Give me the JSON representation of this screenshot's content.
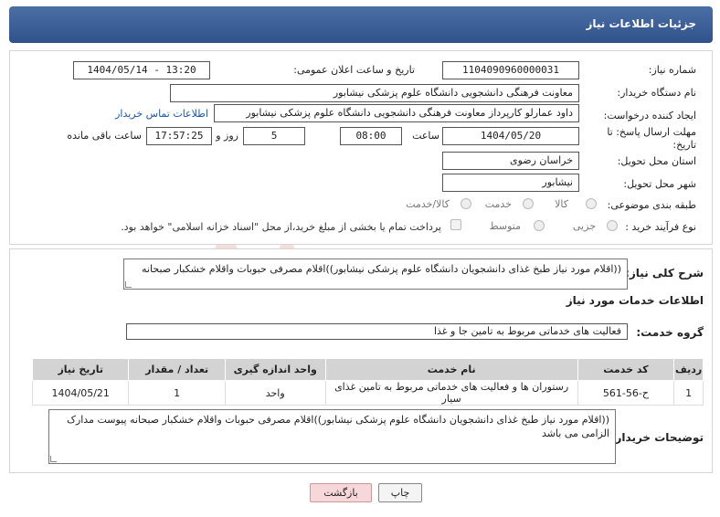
{
  "header": {
    "title": "جزئیات اطلاعات نیاز"
  },
  "need_number": {
    "label": "شماره نیاز:",
    "value": "1104090960000031"
  },
  "announce_datetime": {
    "label": "تاریخ و ساعت اعلان عمومی:",
    "value": "1404/05/14 - 13:20"
  },
  "buyer_org": {
    "label": "نام دستگاه خریدار:",
    "value": "معاونت فرهنگی دانشجویی دانشگاه علوم پزشکی نیشابور"
  },
  "requester": {
    "label": "ایجاد کننده درخواست:",
    "value": "داود عمارلو کارپرداز معاونت فرهنگی دانشجویی دانشگاه علوم پزشکی نیشابور",
    "contact_link": "اطلاعات تماس خریدار"
  },
  "deadline": {
    "label_line1": "مهلت ارسال پاسخ: تا",
    "label_line2": "تاریخ:",
    "date": "1404/05/20",
    "time_label": "ساعت",
    "time": "08:00",
    "days": "5",
    "days_label": "روز و",
    "remaining": "17:57:25",
    "remaining_label": "ساعت باقی مانده"
  },
  "province": {
    "label": "استان محل تحویل:",
    "value": "خراسان رضوی"
  },
  "city": {
    "label": "شهر محل تحویل:",
    "value": "نیشابور"
  },
  "category": {
    "label": "طبقه بندی موضوعی:",
    "options": [
      "کالا",
      "خدمت",
      "کالا/خدمت"
    ],
    "selected": "خدمت"
  },
  "purchase_type": {
    "label": "نوع فرآیند خرید :",
    "options": [
      "جزیی",
      "متوسط"
    ],
    "note": "پرداخت تمام یا بخشی از مبلغ خرید،از محل \"اسناد خزانه اسلامی\" خواهد بود."
  },
  "summary": {
    "label": "شرح کلی نیاز:",
    "value": "((اقلام مورد نیاز طبخ غذای دانشجویان دانشگاه علوم پزشکی نیشابور))اقلام مصرفی حبوبات واقلام خشکبار صبحانه"
  },
  "services_title": "اطلاعات خدمات مورد نیاز",
  "service_group": {
    "label": "گروه خدمت:",
    "value": "فعالیت های خدماتی مربوط به تامین جا و غذا"
  },
  "table": {
    "headers": [
      "ردیف",
      "کد خدمت",
      "نام خدمت",
      "واحد اندازه گیری",
      "تعداد / مقدار",
      "تاریخ نیاز"
    ],
    "rows": [
      [
        "1",
        "ح-56-561",
        "رستوران ها و فعالیت های خدماتی مربوط به تامین غذای سیار",
        "واحد",
        "1",
        "1404/05/21"
      ]
    ]
  },
  "buyer_notes": {
    "label": "توضیحات خریدار:",
    "value": "((اقلام مورد نیاز طبخ غذای دانشجویان دانشگاه علوم پزشکی نیشابور))اقلام مصرفی حبوبات واقلام خشکبار صبحانه پیوست مدارک الزامی می باشد"
  },
  "buttons": {
    "print": "چاپ",
    "back": "بازگشت"
  },
  "watermark": "AriaTender.neT",
  "colors": {
    "header": "#3a5f96",
    "link": "#1a55b0",
    "back_button": "#f8d7da",
    "watermark": "#c0392b"
  }
}
